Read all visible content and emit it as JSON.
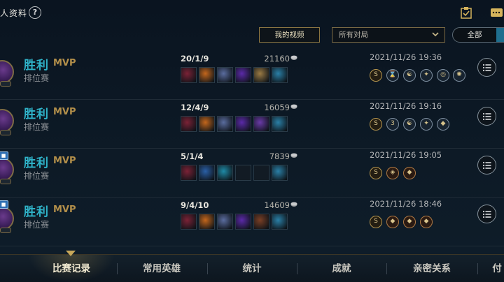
{
  "header": {
    "title": "人资料",
    "help_glyph": "?",
    "my_video_label": "我的视频",
    "mode_filter": "所有对局",
    "segment_all": "全部"
  },
  "matches": [
    {
      "result": "胜利",
      "badge": "MVP",
      "mode": "排位赛",
      "kda": "20/1/9",
      "gold": "21160",
      "date": "2021/11/26 19:36",
      "items": [
        "#7a2236",
        "#c2661c",
        "#5a6c9e",
        "#5b2aa8",
        "#9a7a44",
        "#2a7fa6"
      ],
      "runes": [
        "S",
        "⌛",
        "☯",
        "✦",
        "◎",
        "✺"
      ]
    },
    {
      "result": "胜利",
      "badge": "MVP",
      "mode": "排位赛",
      "kda": "12/4/9",
      "gold": "16059",
      "date": "2021/11/26 19:16",
      "items": [
        "#7a2236",
        "#c2661c",
        "#5a6c9e",
        "#5b2aa8",
        "#6a3ba8",
        "#2a7fa6"
      ],
      "runes": [
        "S",
        "3",
        "☯",
        "✦",
        "◆"
      ]
    },
    {
      "result": "胜利",
      "badge": "MVP",
      "mode": "排位赛",
      "kda": "5/1/4",
      "gold": "7839",
      "date": "2021/11/26 19:05",
      "items": [
        "#7a2236",
        "#2a5fa6",
        "#1f8aa6",
        "",
        "",
        "#2a7fa6"
      ],
      "runes": [
        "S",
        "◈",
        "◆"
      ]
    },
    {
      "result": "胜利",
      "badge": "MVP",
      "mode": "排位赛",
      "kda": "9/4/10",
      "gold": "14609",
      "date": "2021/11/26 18:46",
      "items": [
        "#7a2236",
        "#c2661c",
        "#5a6c9e",
        "#5b2aa8",
        "#7a3f25",
        "#2a7fa6"
      ],
      "runes": [
        "S",
        "◆",
        "◆",
        "◆"
      ]
    }
  ],
  "nav": {
    "tabs": [
      "比赛记录",
      "常用英雄",
      "统计",
      "成就",
      "亲密关系",
      "付"
    ],
    "active": "比赛记录"
  },
  "colors": {
    "accent_teal": "#2fb3c9",
    "mvp_gold": "#b38f4a",
    "frame_gold": "#8c7642"
  }
}
